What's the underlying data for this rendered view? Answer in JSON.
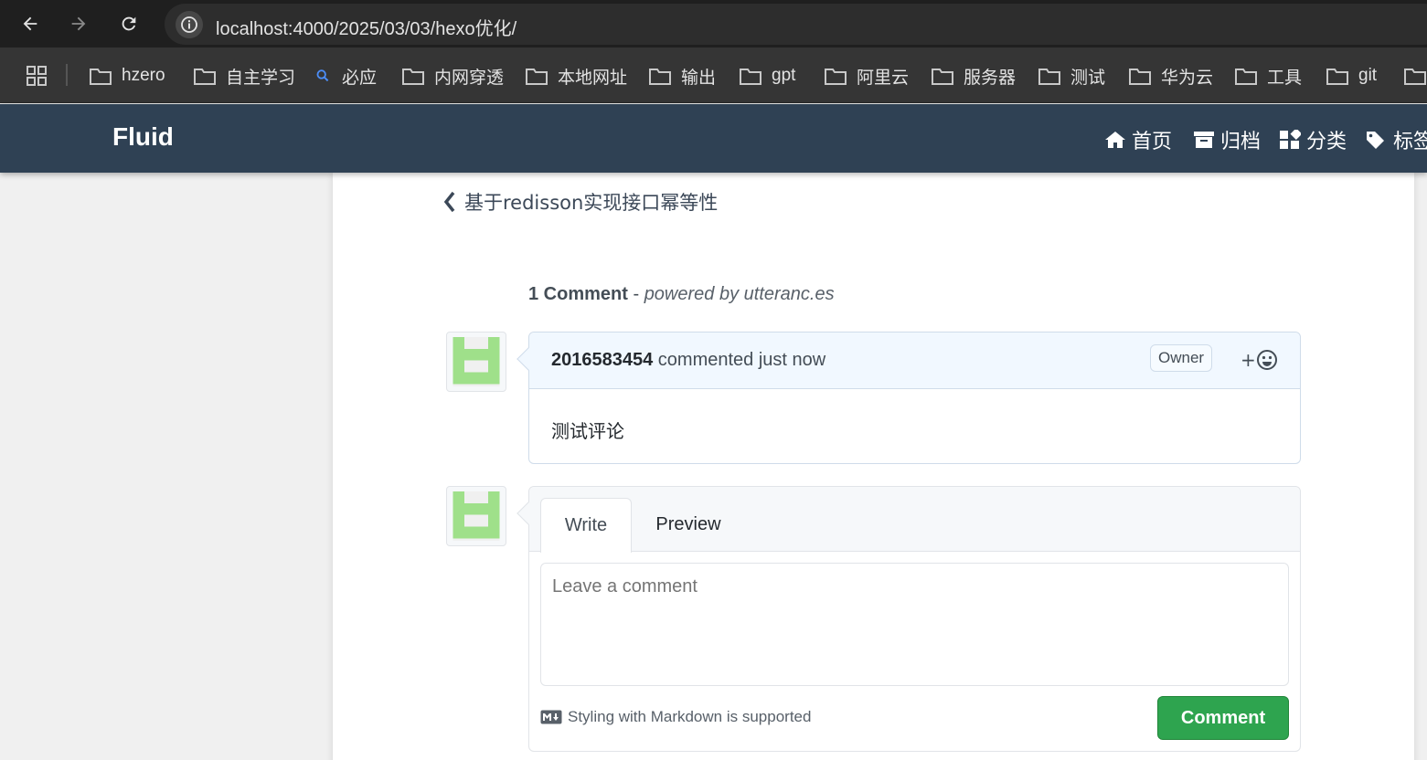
{
  "browser": {
    "url": "localhost:4000/2025/03/03/hexo优化/",
    "bookmarks": [
      {
        "label": "hzero",
        "icon": "folder-icon"
      },
      {
        "label": "自主学习",
        "icon": "folder-icon"
      },
      {
        "label": "必应",
        "icon": "search-icon"
      },
      {
        "label": "内网穿透",
        "icon": "folder-icon"
      },
      {
        "label": "本地网址",
        "icon": "folder-icon"
      },
      {
        "label": "输出",
        "icon": "folder-icon"
      },
      {
        "label": "gpt",
        "icon": "folder-icon"
      },
      {
        "label": "阿里云",
        "icon": "folder-icon"
      },
      {
        "label": "服务器",
        "icon": "folder-icon"
      },
      {
        "label": "测试",
        "icon": "folder-icon"
      },
      {
        "label": "华为云",
        "icon": "folder-icon"
      },
      {
        "label": "工具",
        "icon": "folder-icon"
      },
      {
        "label": "git",
        "icon": "folder-icon"
      }
    ]
  },
  "site": {
    "brand": "Fluid",
    "nav": [
      {
        "label": "首页",
        "icon": "home-icon"
      },
      {
        "label": "归档",
        "icon": "archive-icon"
      },
      {
        "label": "分类",
        "icon": "category-icon"
      },
      {
        "label": "标签",
        "icon": "tag-icon"
      }
    ]
  },
  "post": {
    "prev_link": "基于redisson实现接口幂等性"
  },
  "comments": {
    "count_label": "1 Comment",
    "powered_sep": " - ",
    "powered_by": "powered by utteranc.es",
    "items": [
      {
        "author": "2016583454",
        "action": " commented just now",
        "badge": "Owner",
        "reaction": "+",
        "body": "测试评论"
      }
    ],
    "editor": {
      "tab_write": "Write",
      "tab_preview": "Preview",
      "placeholder": "Leave a comment",
      "markdown_note": "Styling with Markdown is supported",
      "submit": "Comment"
    }
  },
  "colors": {
    "navbar": "#2f4154",
    "submit_button": "#2ea44f",
    "comment_header": "#f1f8ff",
    "avatar_green": "#9fe08a"
  }
}
